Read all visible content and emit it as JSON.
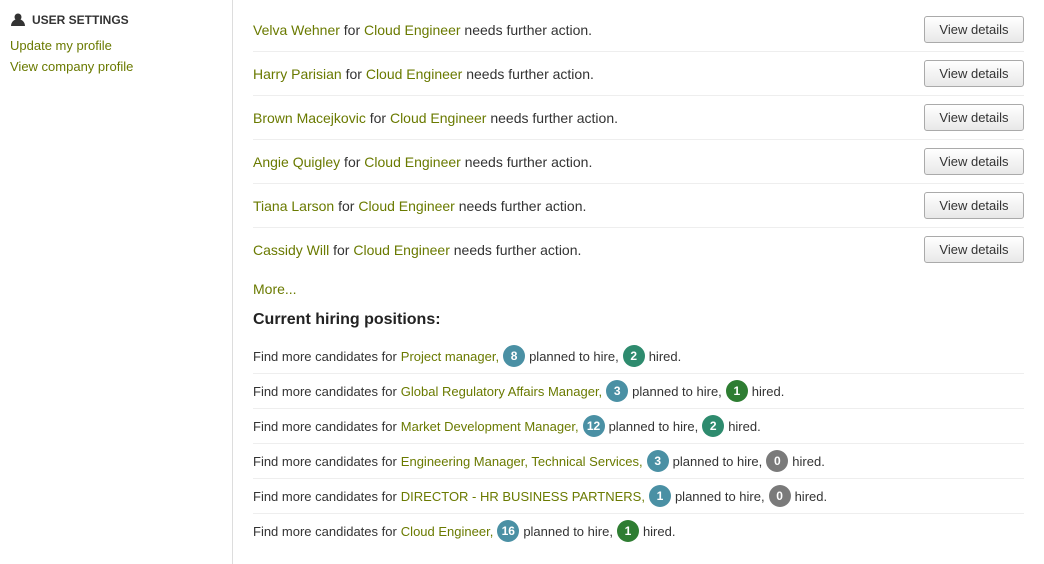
{
  "sidebar": {
    "header": "USER SETTINGS",
    "links": [
      {
        "label": "Update my profile",
        "name": "update-profile-link"
      },
      {
        "label": "View company profile",
        "name": "view-company-profile-link"
      }
    ]
  },
  "notifications": {
    "items": [
      {
        "person": "Velva Wehner",
        "job": "Cloud Engineer",
        "message": " needs further action.",
        "button": "View details"
      },
      {
        "person": "Harry Parisian",
        "job": "Cloud Engineer",
        "message": " needs further action.",
        "button": "View details"
      },
      {
        "person": "Brown Macejkovic",
        "job": "Cloud Engineer",
        "message": " needs further action.",
        "button": "View details"
      },
      {
        "person": "Angie Quigley",
        "job": "Cloud Engineer",
        "message": " needs further action.",
        "button": "View details"
      },
      {
        "person": "Tiana Larson",
        "job": "Cloud Engineer",
        "message": " needs further action.",
        "button": "View details"
      },
      {
        "person": "Cassidy Will",
        "job": "Cloud Engineer",
        "message": " needs further action.",
        "button": "View details"
      }
    ],
    "more_label": "More..."
  },
  "hiring": {
    "title": "Current hiring positions:",
    "prefix": "Find more candidates for",
    "rows": [
      {
        "job": "Project manager",
        "planned": 8,
        "hired": 2,
        "planned_color": "blue",
        "hired_color": "teal"
      },
      {
        "job": "Global Regulatory Affairs Manager",
        "planned": 3,
        "hired": 1,
        "planned_color": "blue",
        "hired_color": "green"
      },
      {
        "job": "Market Development Manager",
        "planned": 12,
        "hired": 2,
        "planned_color": "blue",
        "hired_color": "teal"
      },
      {
        "job": "Engineering Manager, Technical Services",
        "planned": 3,
        "hired": 0,
        "planned_color": "blue",
        "hired_color": "gray"
      },
      {
        "job": "DIRECTOR - HR BUSINESS PARTNERS",
        "planned": 1,
        "hired": 0,
        "planned_color": "blue",
        "hired_color": "gray"
      },
      {
        "job": "Cloud Engineer",
        "planned": 16,
        "hired": 1,
        "planned_color": "blue",
        "hired_color": "green"
      }
    ],
    "planned_label": "planned to hire,",
    "hired_label": "hired."
  }
}
